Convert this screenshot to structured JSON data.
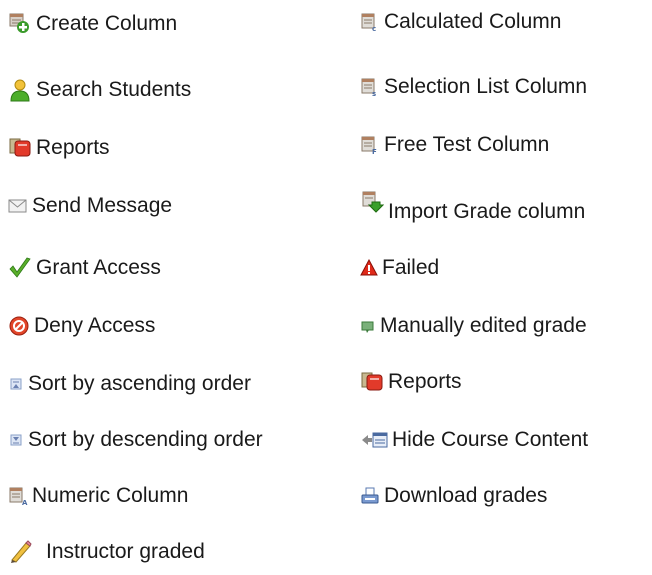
{
  "legend": {
    "left": [
      {
        "icon": "create-column-icon",
        "label": "Create Column"
      },
      {
        "icon": "search-students-icon",
        "label": "Search Students"
      },
      {
        "icon": "reports-icon",
        "label": "Reports"
      },
      {
        "icon": "send-message-icon",
        "label": "Send Message"
      },
      {
        "icon": "grant-access-icon",
        "label": "Grant Access"
      },
      {
        "icon": "deny-access-icon",
        "label": "Deny Access"
      },
      {
        "icon": "sort-ascending-icon",
        "label": "Sort by ascending order"
      },
      {
        "icon": "sort-descending-icon",
        "label": "Sort by descending order"
      },
      {
        "icon": "numeric-column-icon",
        "label": "Numeric Column"
      },
      {
        "icon": "instructor-graded-icon",
        "label": "Instructor graded"
      }
    ],
    "right": [
      {
        "icon": "calculated-column-icon",
        "label": "Calculated Column"
      },
      {
        "icon": "selection-list-column-icon",
        "label": "Selection List Column"
      },
      {
        "icon": "free-test-column-icon",
        "label": "Free Test Column"
      },
      {
        "icon": "import-grade-column-icon",
        "label": "Import Grade column"
      },
      {
        "icon": "failed-icon",
        "label": "Failed"
      },
      {
        "icon": "manually-edited-grade-icon",
        "label": "Manually edited grade"
      },
      {
        "icon": "reports-icon",
        "label": "Reports"
      },
      {
        "icon": "hide-course-content-icon",
        "label": "Hide Course Content"
      },
      {
        "icon": "download-grades-icon",
        "label": "Download grades"
      }
    ]
  }
}
